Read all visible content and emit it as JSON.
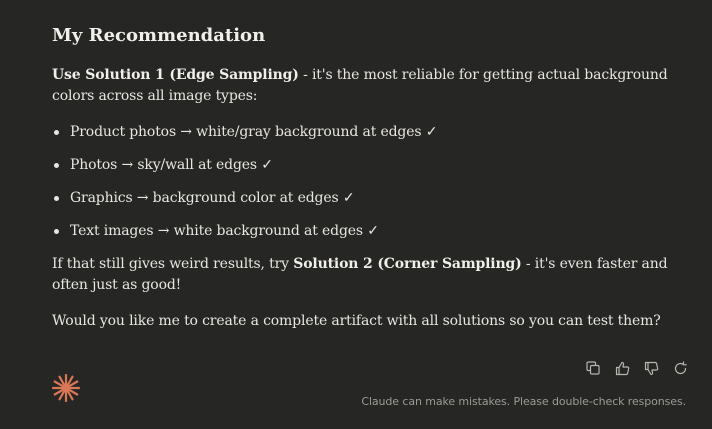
{
  "message": {
    "heading": "My Recommendation",
    "intro": {
      "bold": "Use Solution 1 (Edge Sampling)",
      "rest": " - it's the most reliable for getting actual background colors across all image types:"
    },
    "bullets": [
      "Product photos → white/gray background at edges ✓",
      "Photos → sky/wall at edges ✓",
      "Graphics → background color at edges ✓",
      "Text images → white background at edges ✓"
    ],
    "fallback": {
      "before": "If that still gives weird results, try ",
      "bold": "Solution 2 (Corner Sampling)",
      "after": " - it's even faster and often just as good!"
    },
    "question": "Would you like me to create a complete artifact with all solutions so you can test them?"
  },
  "actions": {
    "copy_icon": "copy-icon",
    "thumbs_up_icon": "thumbs-up-icon",
    "thumbs_down_icon": "thumbs-down-icon",
    "retry_icon": "retry-icon"
  },
  "footer": {
    "disclaimer": "Claude can make mistakes. Please double-check responses."
  },
  "colors": {
    "background": "#262624",
    "text": "#e8e6df",
    "muted": "#9c9a93",
    "brand": "#d97757"
  }
}
